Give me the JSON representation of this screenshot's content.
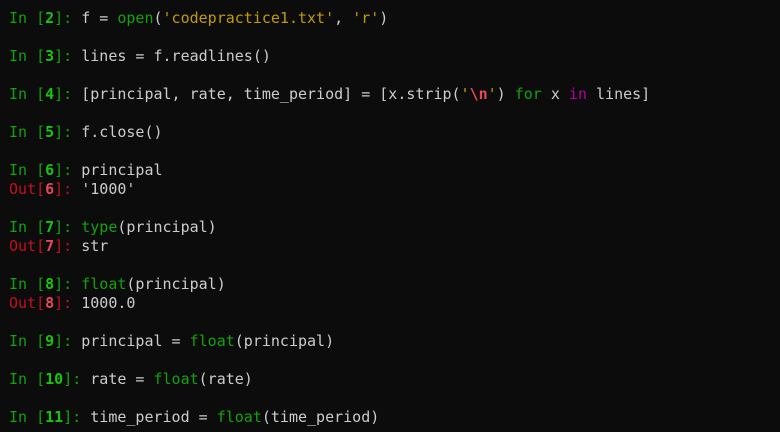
{
  "window": {
    "background": "#0c0c0c",
    "prompt_color": "#13a10e",
    "out_prompt_color": "#c50f1f",
    "string_color": "#c19c00",
    "keyword_color": "#b4009e"
  },
  "lines": [
    {
      "type": "in",
      "n": "2",
      "segments": [
        {
          "t": "f = ",
          "c": "txt"
        },
        {
          "t": "open",
          "c": "kw"
        },
        {
          "t": "(",
          "c": "txt"
        },
        {
          "t": "'codepractice1.txt'",
          "c": "str"
        },
        {
          "t": ", ",
          "c": "txt"
        },
        {
          "t": "'r'",
          "c": "str"
        },
        {
          "t": ")",
          "c": "txt"
        }
      ]
    },
    {
      "type": "in",
      "n": "3",
      "segments": [
        {
          "t": "lines = f.readlines()",
          "c": "txt"
        }
      ]
    },
    {
      "type": "in",
      "n": "4",
      "segments": [
        {
          "t": "[principal, rate, time_period] = [x.strip(",
          "c": "txt"
        },
        {
          "t": "'",
          "c": "str"
        },
        {
          "t": "\\n",
          "c": "onum"
        },
        {
          "t": "'",
          "c": "str"
        },
        {
          "t": ") ",
          "c": "txt"
        },
        {
          "t": "for",
          "c": "kw"
        },
        {
          "t": " x ",
          "c": "txt"
        },
        {
          "t": "in",
          "c": "op"
        },
        {
          "t": " lines]",
          "c": "txt"
        }
      ]
    },
    {
      "type": "in",
      "n": "5",
      "segments": [
        {
          "t": "f.close()",
          "c": "txt"
        }
      ]
    },
    {
      "type": "in",
      "n": "6",
      "segments": [
        {
          "t": "principal",
          "c": "txt"
        }
      ]
    },
    {
      "type": "out",
      "n": "6",
      "segments": [
        {
          "t": "'1000'",
          "c": "txt"
        }
      ]
    },
    {
      "type": "in",
      "n": "7",
      "segments": [
        {
          "t": "type",
          "c": "kw"
        },
        {
          "t": "(principal)",
          "c": "txt"
        }
      ]
    },
    {
      "type": "out",
      "n": "7",
      "segments": [
        {
          "t": "str",
          "c": "txt"
        }
      ]
    },
    {
      "type": "in",
      "n": "8",
      "segments": [
        {
          "t": "float",
          "c": "kw"
        },
        {
          "t": "(principal)",
          "c": "txt"
        }
      ]
    },
    {
      "type": "out",
      "n": "8",
      "segments": [
        {
          "t": "1000.0",
          "c": "txt"
        }
      ]
    },
    {
      "type": "in",
      "n": "9",
      "segments": [
        {
          "t": "principal = ",
          "c": "txt"
        },
        {
          "t": "float",
          "c": "kw"
        },
        {
          "t": "(principal)",
          "c": "txt"
        }
      ]
    },
    {
      "type": "in",
      "n": "10",
      "segments": [
        {
          "t": "rate = ",
          "c": "txt"
        },
        {
          "t": "float",
          "c": "kw"
        },
        {
          "t": "(rate)",
          "c": "txt"
        }
      ]
    },
    {
      "type": "in",
      "n": "11",
      "segments": [
        {
          "t": "time_period = ",
          "c": "txt"
        },
        {
          "t": "float",
          "c": "kw"
        },
        {
          "t": "(time_period)",
          "c": "txt"
        }
      ]
    }
  ]
}
